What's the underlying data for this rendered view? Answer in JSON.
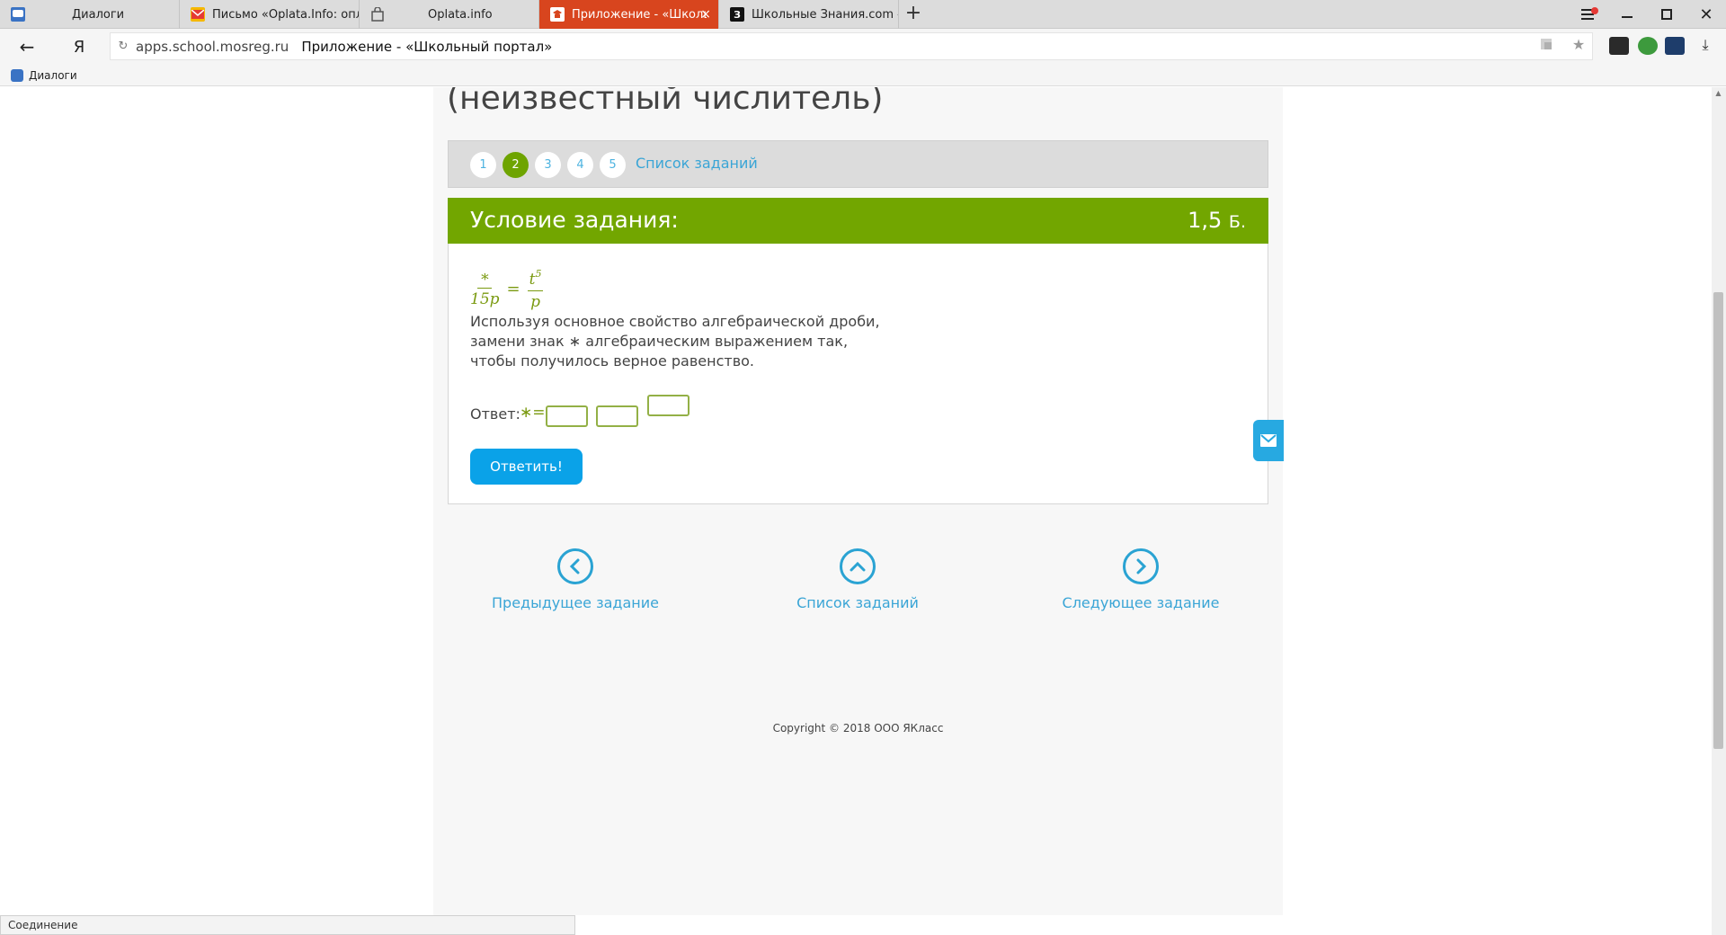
{
  "browser": {
    "tabs": [
      {
        "title": "Диалоги",
        "favicon": "dialogs-icon",
        "color": "#3a73c4"
      },
      {
        "title": "Письмо «Oplata.Info: оплата",
        "favicon": "mail-icon",
        "color": "#f5b800"
      },
      {
        "title": "Oplata.info",
        "favicon": "bag-icon",
        "color": "#888888"
      },
      {
        "title": "Приложение - «Школьн",
        "favicon": "school-portal-icon",
        "color": "#d8451e",
        "active": true
      },
      {
        "title": "Школьные Знания.com - Ре",
        "favicon": "znanija-icon",
        "color": "#111111"
      }
    ],
    "address": {
      "domain": "apps.school.mosreg.ru",
      "page_title": "Приложение - «Школьный портал»",
      "back_label": "←",
      "yandex_label": "Я"
    },
    "bookmarks": [
      {
        "label": "Диалоги"
      }
    ],
    "status_text": "Соединение"
  },
  "page": {
    "heading": "(неизвестный числитель)",
    "task_nav": {
      "tasks": [
        "1",
        "2",
        "3",
        "4",
        "5"
      ],
      "current": "2",
      "list_link": "Список заданий"
    },
    "condition": {
      "title": "Условие задания:",
      "points": "1,5",
      "points_unit": "Б.",
      "formula": {
        "left_num": "∗",
        "left_den": "15p",
        "right_num": "t",
        "right_num_exp": "5",
        "right_den": "p",
        "eq": "="
      },
      "statement_lines": [
        "Используя основное свойство алгебраической дроби,",
        "замени знак ∗ алгебраическим выражением так,",
        "чтобы получилось верное равенство."
      ],
      "answer_label": "Ответ:",
      "answer_prefix": "∗=",
      "submit_label": "Ответить!"
    },
    "pager": {
      "prev": "Предыдущее задание",
      "list": "Список заданий",
      "next": "Следующее задание"
    },
    "copyright": "Copyright © 2018 ООО ЯКласс"
  },
  "colors": {
    "accent_green": "#72a600",
    "link_blue": "#3aa5d6",
    "button_blue": "#0aa2e8",
    "active_tab": "#d8451e"
  }
}
